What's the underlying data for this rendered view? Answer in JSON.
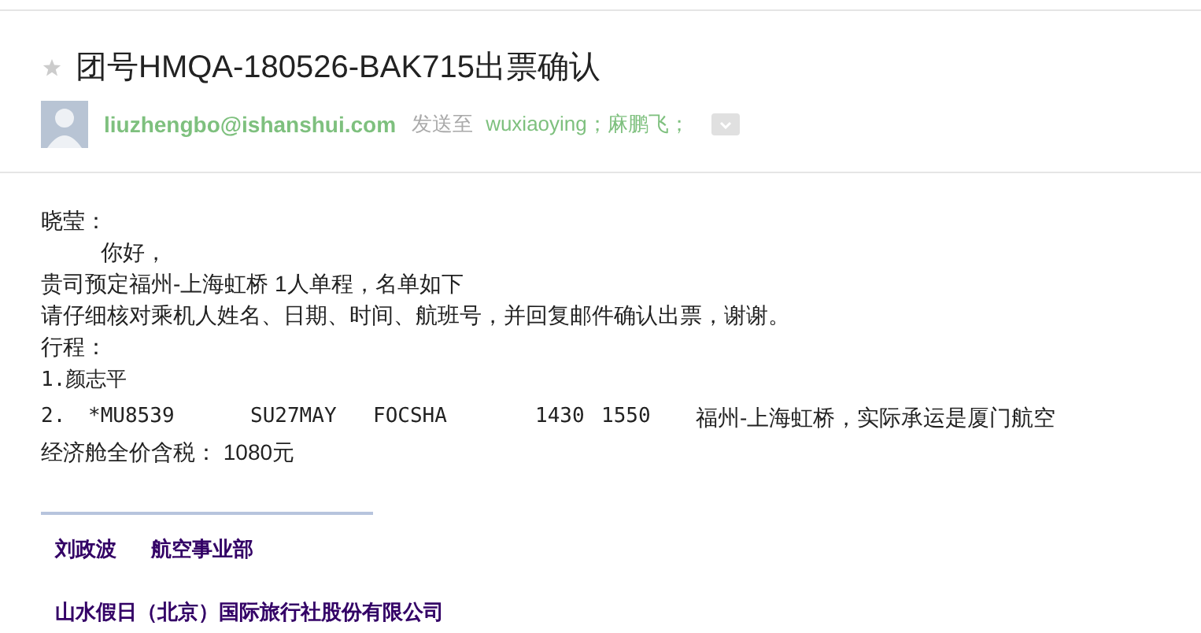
{
  "subject": {
    "starred": false,
    "title": "团号HMQA-180526-BAK715出票确认"
  },
  "sender": {
    "address": "liuzhengbo@ishanshui.com",
    "sent_to_label": "发送至",
    "recipients": [
      "wuxiaoying",
      "麻鹏飞"
    ],
    "separator": "；"
  },
  "body": {
    "greeting": "晓莹：",
    "salutation": "你好，",
    "lines": [
      "贵司预定福州-上海虹桥 1人单程，名单如下",
      "请仔细核对乘机人姓名、日期、时间、航班号，并回复邮件确认出票，谢谢。",
      "行程："
    ],
    "passenger": "1.颜志平",
    "flight": [
      "2.",
      "*MU8539",
      "SU27MAY",
      "FOCSHA",
      "1430",
      "1550",
      "福州-上海虹桥，实际承运是厦门航空"
    ],
    "price": "经济舱全价含税： 1080元"
  },
  "signature": {
    "name": "刘政波",
    "department": "航空事业部",
    "company": "山水假日（北京）国际旅行社股份有限公司"
  }
}
